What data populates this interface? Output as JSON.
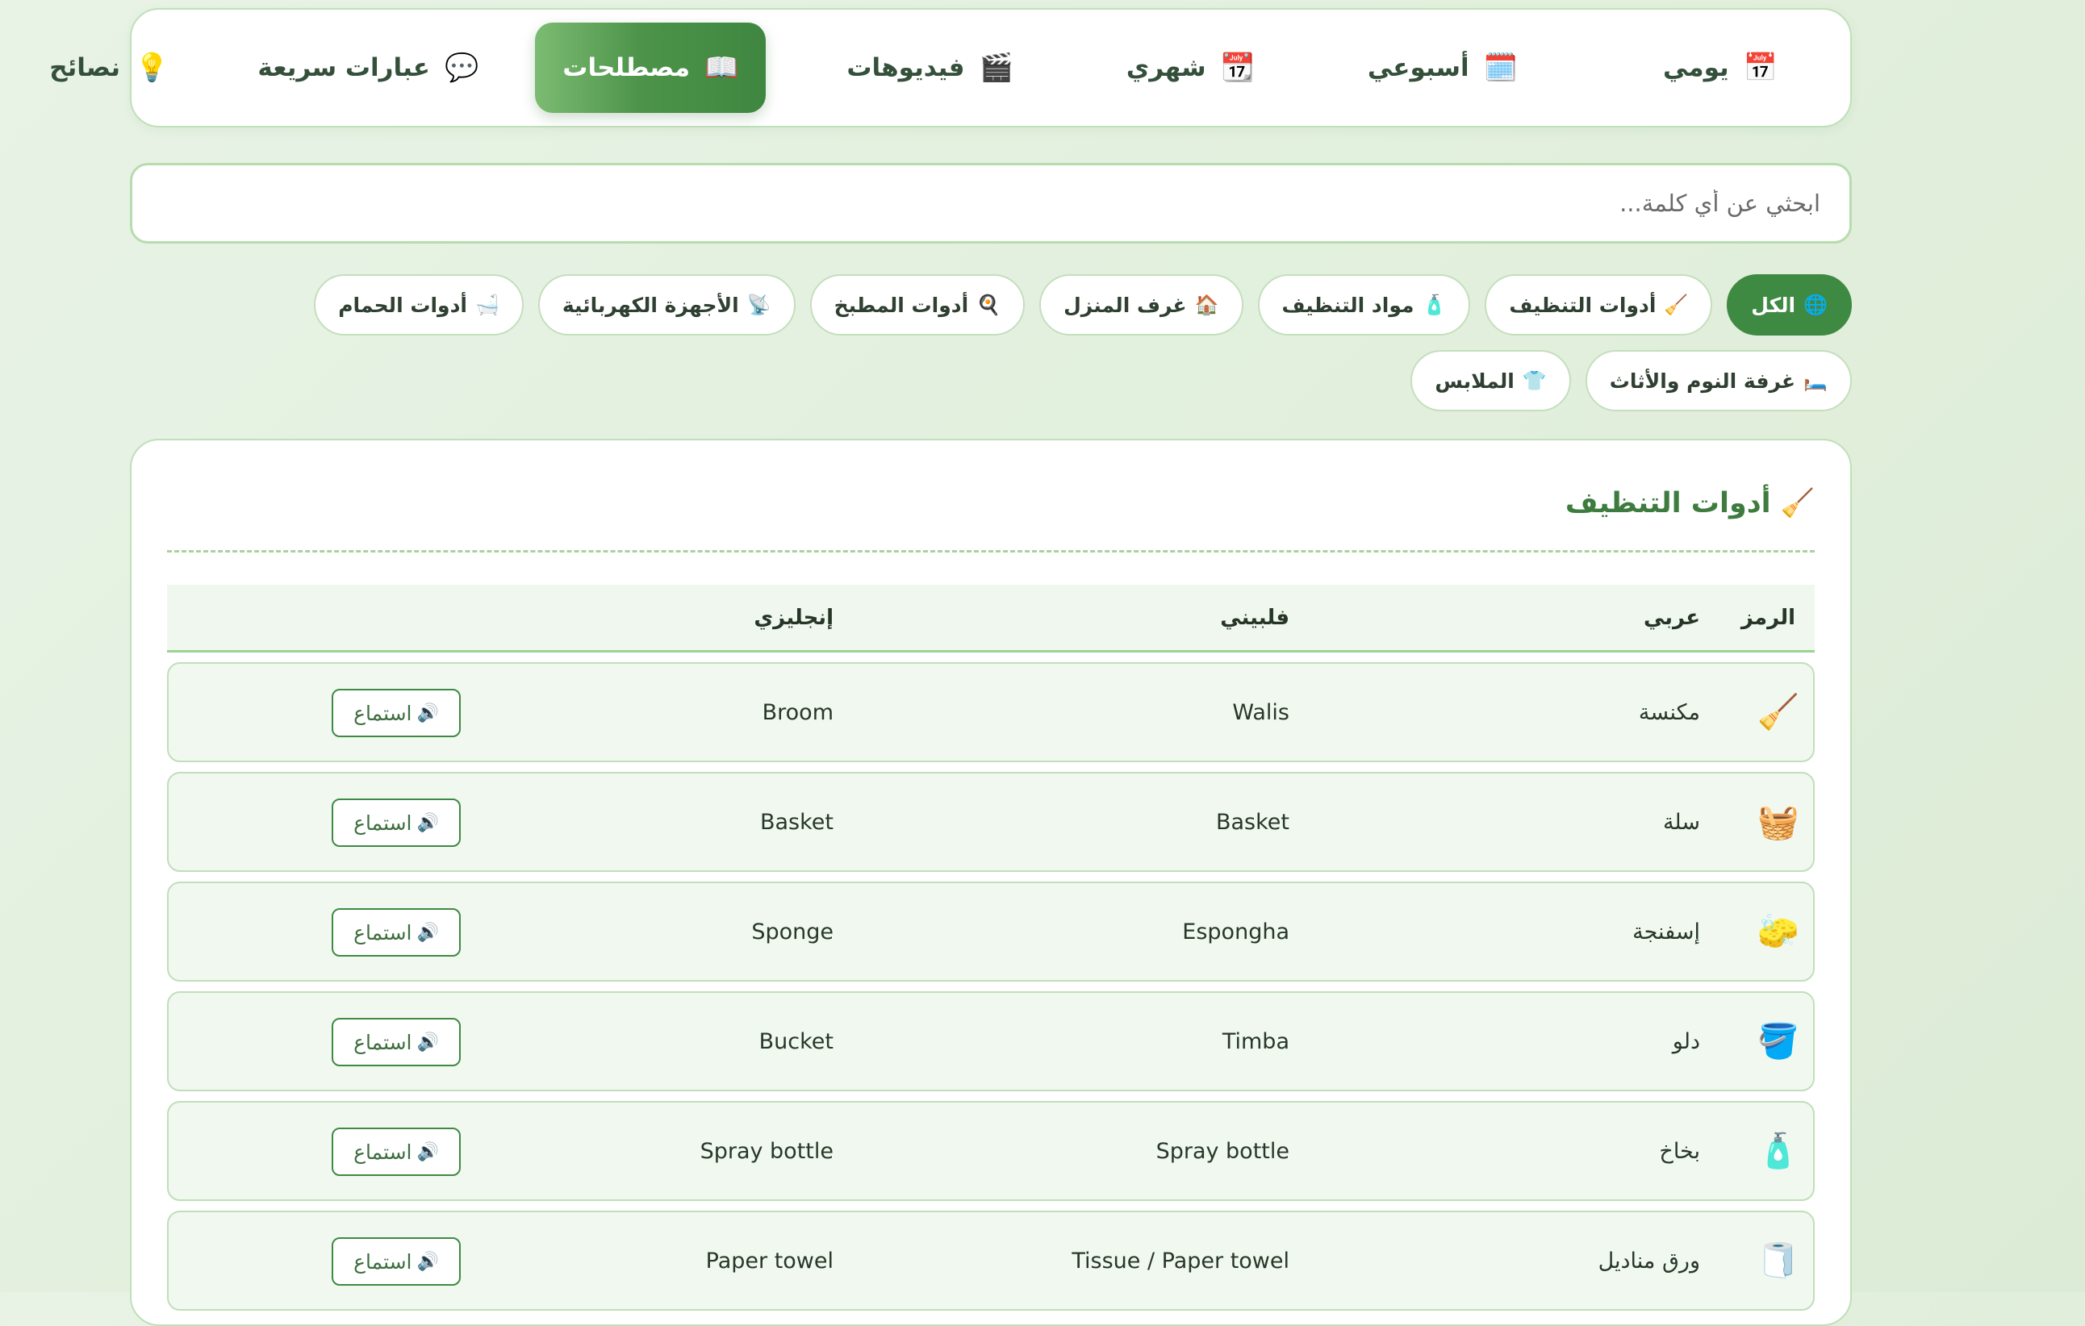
{
  "nav": {
    "tabs": [
      {
        "label": "يومي",
        "icon": "📅"
      },
      {
        "label": "أسبوعي",
        "icon": "🗓️"
      },
      {
        "label": "شهري",
        "icon": "📆"
      },
      {
        "label": "فيديوهات",
        "icon": "🎬"
      },
      {
        "label": "مصطلحات",
        "icon": "📖"
      },
      {
        "label": "عبارات سريعة",
        "icon": "💬"
      },
      {
        "label": "نصائح",
        "icon": "💡"
      }
    ],
    "active_index": 4
  },
  "search": {
    "placeholder": "ابحثي عن أي كلمة..."
  },
  "filters": [
    {
      "label": "الكل",
      "icon": "🌐"
    },
    {
      "label": "أدوات التنظيف",
      "icon": "🧹"
    },
    {
      "label": "مواد التنظيف",
      "icon": "🧴"
    },
    {
      "label": "غرف المنزل",
      "icon": "🏠"
    },
    {
      "label": "أدوات المطبخ",
      "icon": "🍳"
    },
    {
      "label": "الأجهزة الكهربائية",
      "icon": "📡"
    },
    {
      "label": "أدوات الحمام",
      "icon": "🛁"
    },
    {
      "label": "غرفة النوم والأثاث",
      "icon": "🛏️"
    },
    {
      "label": "الملابس",
      "icon": "👕"
    }
  ],
  "section": {
    "title": "أدوات التنظيف",
    "icon": "🧹",
    "headers": {
      "symbol": "الرمز",
      "arabic": "عربي",
      "filipino": "فلبيني",
      "english": "إنجليزي"
    },
    "listen_label": "استماع",
    "listen_icon": "🔊",
    "rows": [
      {
        "icon": "🧹",
        "arabic": "مكنسة",
        "filipino": "Walis",
        "english": "Broom"
      },
      {
        "icon": "🧺",
        "arabic": "سلة",
        "filipino": "Basket",
        "english": "Basket"
      },
      {
        "icon": "🧽",
        "arabic": "إسفنجة",
        "filipino": "Espongha",
        "english": "Sponge"
      },
      {
        "icon": "🪣",
        "arabic": "دلو",
        "filipino": "Timba",
        "english": "Bucket"
      },
      {
        "icon": "🧴",
        "arabic": "بخاخ",
        "filipino": "Spray bottle",
        "english": "Spray bottle"
      },
      {
        "icon": "🧻",
        "arabic": "ورق مناديل",
        "filipino": "Tissue / Paper towel",
        "english": "Paper towel"
      }
    ]
  },
  "colors": {
    "accent": "#3f8a43",
    "accent_light": "#7cbb72",
    "background": "#e3f0df",
    "row_bg": "#f1f8f0",
    "border": "#bfe0b9"
  }
}
